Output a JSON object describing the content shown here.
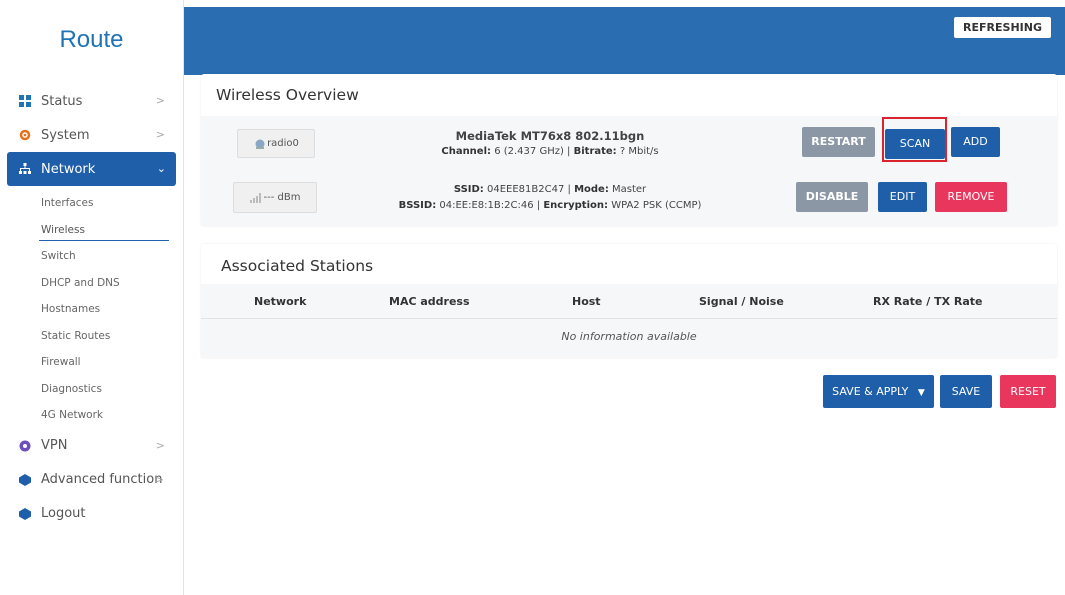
{
  "brand": "Route",
  "menu": [
    {
      "label": "Status",
      "icon": "status-grid-icon"
    },
    {
      "label": "System",
      "icon": "gear-icon"
    },
    {
      "label": "Network",
      "icon": "network-icon"
    },
    {
      "label": "VPN",
      "icon": "vpn-icon"
    },
    {
      "label": "Advanced function",
      "icon": "advanced-icon"
    },
    {
      "label": "Logout",
      "icon": "logout-icon"
    }
  ],
  "network_sub": [
    "Interfaces",
    "Wireless",
    "Switch",
    "DHCP and DNS",
    "Hostnames",
    "Static Routes",
    "Firewall",
    "Diagnostics",
    "4G Network"
  ],
  "refreshing": "REFRESHING",
  "overview": {
    "title": "Wireless Overview",
    "radio_btn": "radio0",
    "device_name": "MediaTek MT76x8 802.11bgn",
    "channel_label": "Channel:",
    "channel_value": "6 (2.437 GHz)",
    "bitrate_label": "Bitrate:",
    "bitrate_value": "? Mbit/s",
    "signal_btn": "--- dBm",
    "ssid_label": "SSID:",
    "ssid_value": "04EEE81B2C47",
    "mode_label": "Mode:",
    "mode_value": "Master",
    "bssid_label": "BSSID:",
    "bssid_value": "04:EE:E8:1B:2C:46",
    "enc_label": "Encryption:",
    "enc_value": "WPA2 PSK (CCMP)",
    "buttons": {
      "restart": "RESTART",
      "scan": "SCAN",
      "add": "ADD",
      "disable": "DISABLE",
      "edit": "EDIT",
      "remove": "REMOVE"
    }
  },
  "stations": {
    "title": "Associated Stations",
    "columns": [
      "Network",
      "MAC address",
      "Host",
      "Signal / Noise",
      "RX Rate / TX Rate"
    ],
    "empty": "No information available"
  },
  "footer": {
    "save_apply": "SAVE & APPLY",
    "save": "SAVE",
    "reset": "RESET"
  },
  "colors": {
    "primary": "#1f5fa9",
    "topbar": "#2a6db1",
    "danger": "#e8365d",
    "muted_button": "#8b97a5",
    "highlight": "#d9232d"
  }
}
